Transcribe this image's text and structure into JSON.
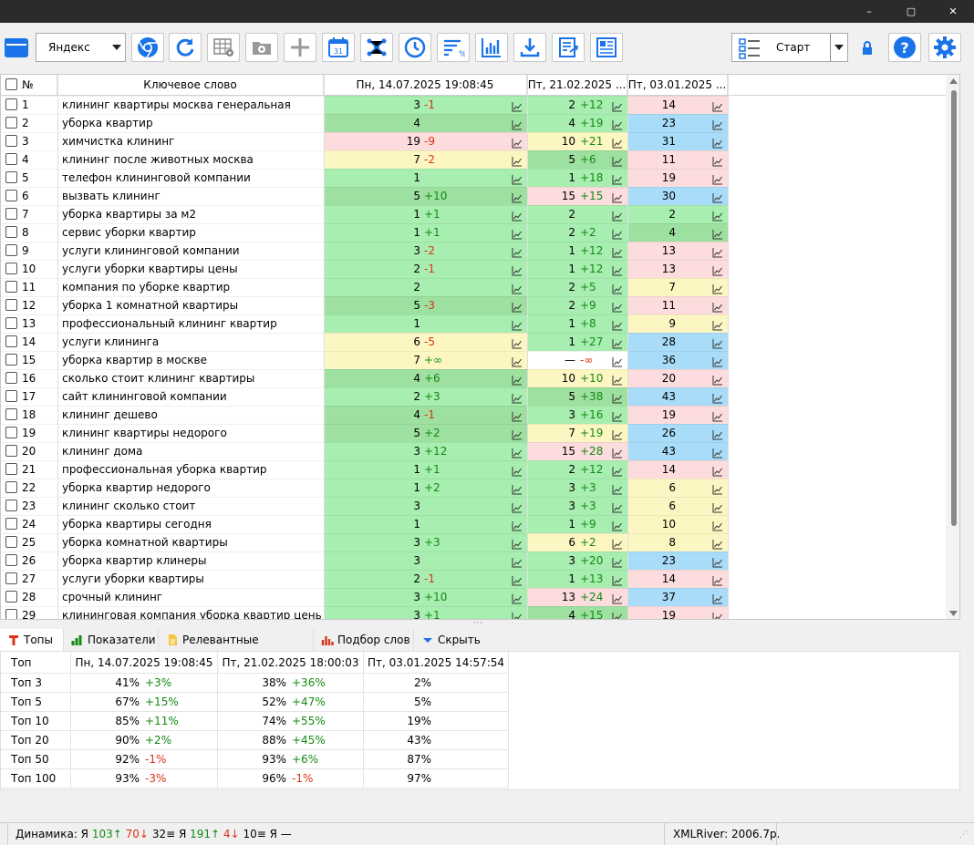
{
  "window": {
    "controls": [
      "–",
      "▢",
      "✕"
    ]
  },
  "toolbar": {
    "engine_select": "Яндекс",
    "start_button": "Старт",
    "calendar_day": "31",
    "accent": "#1a73e8"
  },
  "grid": {
    "headers": {
      "num": "№",
      "keyword": "Ключевое слово",
      "col1": "Пн, 14.07.2025 19:08:45",
      "col2": "Пт, 21.02.2025 ...",
      "col3": "Пт, 03.01.2025 ..."
    },
    "rows": [
      {
        "n": "1",
        "kw": "клининг квартиры москва генеральная",
        "p1": "3",
        "d1": "-1",
        "b1": "g",
        "p2": "2",
        "d2": "+12",
        "b2": "g",
        "p3": "14",
        "b3": "r"
      },
      {
        "n": "2",
        "kw": "уборка квартир",
        "p1": "4",
        "d1": "",
        "b1": "dg",
        "p2": "4",
        "d2": "+19",
        "b2": "g",
        "p3": "23",
        "b3": "b"
      },
      {
        "n": "3",
        "kw": "химчистка клининг",
        "p1": "19",
        "d1": "-9",
        "b1": "r",
        "p2": "10",
        "d2": "+21",
        "b2": "y",
        "p3": "31",
        "b3": "b"
      },
      {
        "n": "4",
        "kw": "клининг после животных москва",
        "p1": "7",
        "d1": "-2",
        "b1": "y",
        "p2": "5",
        "d2": "+6",
        "b2": "dg",
        "p3": "11",
        "b3": "r"
      },
      {
        "n": "5",
        "kw": "телефон клининговой компании",
        "p1": "1",
        "d1": "",
        "b1": "g",
        "p2": "1",
        "d2": "+18",
        "b2": "g",
        "p3": "19",
        "b3": "r"
      },
      {
        "n": "6",
        "kw": "вызвать клининг",
        "p1": "5",
        "d1": "+10",
        "b1": "dg",
        "p2": "15",
        "d2": "+15",
        "b2": "r",
        "p3": "30",
        "b3": "b"
      },
      {
        "n": "7",
        "kw": "уборка квартиры за м2",
        "p1": "1",
        "d1": "+1",
        "b1": "g",
        "p2": "2",
        "d2": "",
        "b2": "g",
        "p3": "2",
        "b3": "g"
      },
      {
        "n": "8",
        "kw": "сервис уборки квартир",
        "p1": "1",
        "d1": "+1",
        "b1": "g",
        "p2": "2",
        "d2": "+2",
        "b2": "g",
        "p3": "4",
        "b3": "dg"
      },
      {
        "n": "9",
        "kw": "услуги клининговой компании",
        "p1": "3",
        "d1": "-2",
        "b1": "g",
        "p2": "1",
        "d2": "+12",
        "b2": "g",
        "p3": "13",
        "b3": "r"
      },
      {
        "n": "10",
        "kw": "услуги уборки квартиры цены",
        "p1": "2",
        "d1": "-1",
        "b1": "g",
        "p2": "1",
        "d2": "+12",
        "b2": "g",
        "p3": "13",
        "b3": "r"
      },
      {
        "n": "11",
        "kw": "компания по уборке квартир",
        "p1": "2",
        "d1": "",
        "b1": "g",
        "p2": "2",
        "d2": "+5",
        "b2": "g",
        "p3": "7",
        "b3": "y"
      },
      {
        "n": "12",
        "kw": "уборка 1 комнатной квартиры",
        "p1": "5",
        "d1": "-3",
        "b1": "dg",
        "p2": "2",
        "d2": "+9",
        "b2": "g",
        "p3": "11",
        "b3": "r"
      },
      {
        "n": "13",
        "kw": "профессиональный клининг квартир",
        "p1": "1",
        "d1": "",
        "b1": "g",
        "p2": "1",
        "d2": "+8",
        "b2": "g",
        "p3": "9",
        "b3": "y"
      },
      {
        "n": "14",
        "kw": "услуги клининга",
        "p1": "6",
        "d1": "-5",
        "b1": "y",
        "p2": "1",
        "d2": "+27",
        "b2": "g",
        "p3": "28",
        "b3": "b"
      },
      {
        "n": "15",
        "kw": "уборка квартир в москве",
        "p1": "7",
        "d1": "+∞",
        "b1": "y",
        "p2": "—",
        "d2": "-∞",
        "b2": "w",
        "p3": "36",
        "b3": "b"
      },
      {
        "n": "16",
        "kw": "сколько стоит клининг квартиры",
        "p1": "4",
        "d1": "+6",
        "b1": "dg",
        "p2": "10",
        "d2": "+10",
        "b2": "y",
        "p3": "20",
        "b3": "r"
      },
      {
        "n": "17",
        "kw": "сайт клининговой компании",
        "p1": "2",
        "d1": "+3",
        "b1": "g",
        "p2": "5",
        "d2": "+38",
        "b2": "dg",
        "p3": "43",
        "b3": "b"
      },
      {
        "n": "18",
        "kw": "клининг дешево",
        "p1": "4",
        "d1": "-1",
        "b1": "dg",
        "p2": "3",
        "d2": "+16",
        "b2": "g",
        "p3": "19",
        "b3": "r"
      },
      {
        "n": "19",
        "kw": "клининг квартиры недорого",
        "p1": "5",
        "d1": "+2",
        "b1": "dg",
        "p2": "7",
        "d2": "+19",
        "b2": "y",
        "p3": "26",
        "b3": "b"
      },
      {
        "n": "20",
        "kw": "клининг дома",
        "p1": "3",
        "d1": "+12",
        "b1": "g",
        "p2": "15",
        "d2": "+28",
        "b2": "r",
        "p3": "43",
        "b3": "b"
      },
      {
        "n": "21",
        "kw": "профессиональная уборка квартир",
        "p1": "1",
        "d1": "+1",
        "b1": "g",
        "p2": "2",
        "d2": "+12",
        "b2": "g",
        "p3": "14",
        "b3": "r"
      },
      {
        "n": "22",
        "kw": "уборка квартир недорого",
        "p1": "1",
        "d1": "+2",
        "b1": "g",
        "p2": "3",
        "d2": "+3",
        "b2": "g",
        "p3": "6",
        "b3": "y"
      },
      {
        "n": "23",
        "kw": "клининг сколько стоит",
        "p1": "3",
        "d1": "",
        "b1": "g",
        "p2": "3",
        "d2": "+3",
        "b2": "g",
        "p3": "6",
        "b3": "y"
      },
      {
        "n": "24",
        "kw": "уборка квартиры сегодня",
        "p1": "1",
        "d1": "",
        "b1": "g",
        "p2": "1",
        "d2": "+9",
        "b2": "g",
        "p3": "10",
        "b3": "y"
      },
      {
        "n": "25",
        "kw": "уборка комнатной квартиры",
        "p1": "3",
        "d1": "+3",
        "b1": "g",
        "p2": "6",
        "d2": "+2",
        "b2": "y",
        "p3": "8",
        "b3": "y"
      },
      {
        "n": "26",
        "kw": "уборка квартир клинеры",
        "p1": "3",
        "d1": "",
        "b1": "g",
        "p2": "3",
        "d2": "+20",
        "b2": "g",
        "p3": "23",
        "b3": "b"
      },
      {
        "n": "27",
        "kw": "услуги уборки квартиры",
        "p1": "2",
        "d1": "-1",
        "b1": "g",
        "p2": "1",
        "d2": "+13",
        "b2": "g",
        "p3": "14",
        "b3": "r"
      },
      {
        "n": "28",
        "kw": "срочный клининг",
        "p1": "3",
        "d1": "+10",
        "b1": "g",
        "p2": "13",
        "d2": "+24",
        "b2": "r",
        "p3": "37",
        "b3": "b"
      },
      {
        "n": "29",
        "kw": "клининговая компания уборка квартир цены",
        "p1": "3",
        "d1": "+1",
        "b1": "g",
        "p2": "4",
        "d2": "+15",
        "b2": "dg",
        "p3": "19",
        "b3": "r"
      }
    ]
  },
  "bottom_tabs": [
    "Топы",
    "Показатели",
    "Релевантные страницы",
    "Подбор слов",
    "Скрыть"
  ],
  "tops": {
    "headers": [
      "Топ",
      "Пн, 14.07.2025 19:08:45",
      "Пт, 21.02.2025 18:00:03",
      "Пт, 03.01.2025 14:57:54"
    ],
    "rows": [
      {
        "label": "Топ 3",
        "v1": "41%",
        "d1": "+3%",
        "v2": "38%",
        "d2": "+36%",
        "v3": "2%"
      },
      {
        "label": "Топ 5",
        "v1": "67%",
        "d1": "+15%",
        "v2": "52%",
        "d2": "+47%",
        "v3": "5%"
      },
      {
        "label": "Топ 10",
        "v1": "85%",
        "d1": "+11%",
        "v2": "74%",
        "d2": "+55%",
        "v3": "19%"
      },
      {
        "label": "Топ 20",
        "v1": "90%",
        "d1": "+2%",
        "v2": "88%",
        "d2": "+45%",
        "v3": "43%"
      },
      {
        "label": "Топ 50",
        "v1": "92%",
        "d1": "-1%",
        "v2": "93%",
        "d2": "+6%",
        "v3": "87%"
      },
      {
        "label": "Топ 100",
        "v1": "93%",
        "d1": "-3%",
        "v2": "96%",
        "d2": "-1%",
        "v3": "97%"
      }
    ]
  },
  "status": {
    "dynamics_label": "Динамика: Я",
    "up_val": "103↑",
    "down_val": "70↓",
    "eq_val": "32≡ Я",
    "up2": "191↑",
    "down2": "4↓",
    "eq2": "10≡ Я —",
    "balance": "XMLRiver: 2006.7р."
  }
}
